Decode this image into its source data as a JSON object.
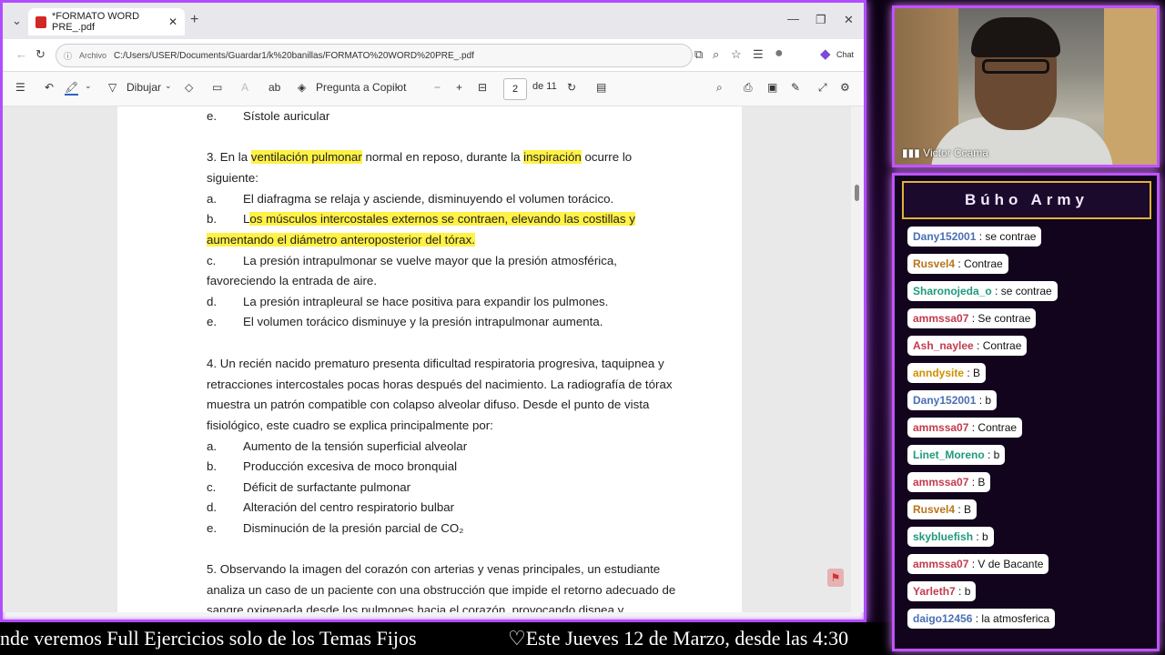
{
  "browser": {
    "tab_title": "*FORMATO WORD PRE_.pdf",
    "address_label": "Archivo",
    "address": "C:/Users/USER/Documents/Guardar1/k%20banillas/FORMATO%20WORD%20PRE_.pdf",
    "chat_button": "Chat",
    "toolbar": {
      "draw": "Dibujar",
      "ask_copilot": "Pregunta a Copilot",
      "page_current": "2",
      "page_total": "de 11"
    }
  },
  "document": {
    "l1_letter": "e.",
    "l1_text": "Sístole auricular",
    "q3_a": "3. En la ",
    "q3_h1": "ventilación pulmonar",
    "q3_b": " normal en reposo, durante la ",
    "q3_h2": "inspiración",
    "q3_c": " ocurre lo",
    "q3_line2": "siguiente:",
    "q3_opt_a_letter": "a.",
    "q3_opt_a": "El diafragma se relaja y asciende, disminuyendo el volumen torácico.",
    "q3_opt_b_letter": "b.",
    "q3_opt_b1_plain": "L",
    "q3_opt_b1": "os músculos intercostales externos se contraen, elevando las costillas y",
    "q3_opt_b2": "aumentando el diámetro anteroposterior del tórax.",
    "q3_opt_c_letter": "c.",
    "q3_opt_c1": "La presión intrapulmonar se vuelve mayor que la presión atmosférica,",
    "q3_opt_c2": "favoreciendo la entrada de aire.",
    "q3_opt_d_letter": "d.",
    "q3_opt_d": "La presión intrapleural se hace positiva para expandir los pulmones.",
    "q3_opt_e_letter": "e.",
    "q3_opt_e": "El volumen torácico disminuye y la presión intrapulmonar aumenta.",
    "q4_1": "4. Un recién nacido prematuro presenta dificultad respiratoria progresiva, taquipnea y",
    "q4_2": "retracciones intercostales pocas horas después del nacimiento. La radiografía de tórax",
    "q4_3": "muestra un patrón compatible con colapso alveolar difuso. Desde el punto de vista",
    "q4_4": "fisiológico, este cuadro se explica principalmente por:",
    "q4_opts": [
      {
        "letter": "a.",
        "text": "Aumento de la tensión superficial alveolar"
      },
      {
        "letter": "b.",
        "text": "Producción excesiva de moco bronquial"
      },
      {
        "letter": "c.",
        "text": "Déficit de surfactante pulmonar"
      },
      {
        "letter": "d.",
        "text": "Alteración del centro respiratorio bulbar"
      },
      {
        "letter": "e.",
        "text": "Disminución de la presión parcial de CO₂"
      }
    ],
    "q5_1": "5. Observando la imagen del corazón con arterias y venas principales, un estudiante",
    "q5_2": "analiza un caso de un paciente con una obstrucción que impide el retorno adecuado de",
    "q5_3": "sangre oxigenada desde los pulmones hacia el corazón, provocando disnea y"
  },
  "ticker": {
    "left": "nde veremos Full Ejercicios solo de los Temas Fijos",
    "right": "♡Este Jueves 12 de Marzo, desde las 4:30"
  },
  "webcam": {
    "name": "Victor Ccama"
  },
  "chat": {
    "title": "Búho Army",
    "messages": [
      {
        "user": "Dany152001",
        "text": ": se contrae",
        "color": "#4a6fb5"
      },
      {
        "user": "Rusvel4",
        "text": ": Contrae",
        "color": "#b8751c"
      },
      {
        "user": "Sharonojeda_o",
        "text": ": se contrae",
        "color": "#1f9a7a"
      },
      {
        "user": "ammssa07",
        "text": ": Se contrae",
        "color": "#c23b4e"
      },
      {
        "user": "Ash_naylee",
        "text": ": Contrae",
        "color": "#c23b4e"
      },
      {
        "user": "anndysite",
        "text": ": B",
        "color": "#d09000"
      },
      {
        "user": "Dany152001",
        "text": ": b",
        "color": "#4a6fb5"
      },
      {
        "user": "ammssa07",
        "text": ": Contrae",
        "color": "#c23b4e"
      },
      {
        "user": "Linet_Moreno",
        "text": ": b",
        "color": "#1f9a7a"
      },
      {
        "user": "ammssa07",
        "text": ": B",
        "color": "#c23b4e"
      },
      {
        "user": "Rusvel4",
        "text": ": B",
        "color": "#b8751c"
      },
      {
        "user": "skybluefish",
        "text": ": b",
        "color": "#1f9a7a"
      },
      {
        "user": "ammssa07",
        "text": ": V de Bacante",
        "color": "#c23b4e"
      },
      {
        "user": "Yarleth7",
        "text": ": b",
        "color": "#c23b4e"
      },
      {
        "user": "daigo12456",
        "text": ": la atmosferica",
        "color": "#4a6fb5"
      }
    ]
  },
  "colors": {
    "neon_border": "#c053ff",
    "highlight": "#fff145",
    "title_frame": "#e0b13a"
  }
}
